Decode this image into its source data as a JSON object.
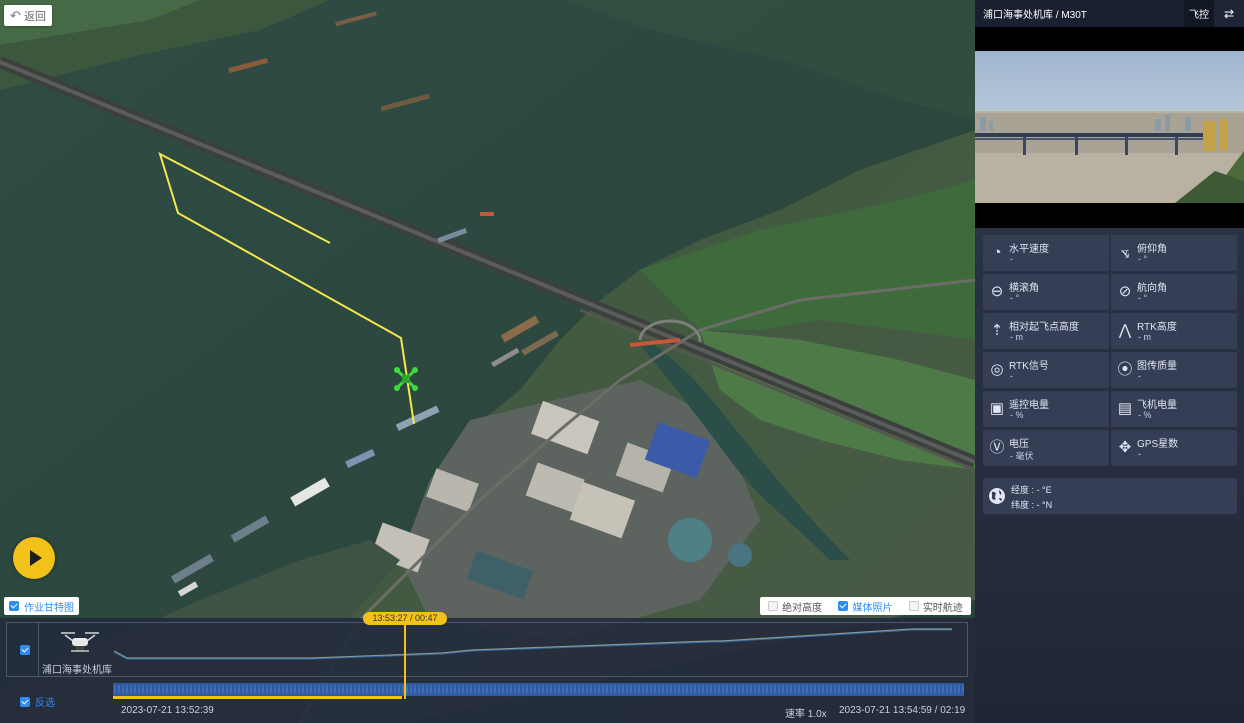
{
  "map": {
    "back_label": "返回",
    "gantt_label": "作业甘特图",
    "layer_options": [
      {
        "label": "绝对高度",
        "checked": false
      },
      {
        "label": "媒体照片",
        "checked": true
      },
      {
        "label": "实时航迹",
        "checked": false
      }
    ],
    "flight_path_color": "#f5e84a",
    "drone_marker_color": "#3ddb3d"
  },
  "timeline": {
    "drone_label": "浦口海事处机库",
    "invert_label": "反选",
    "cursor_time": "13:53:27 / 00:47",
    "start_time": "2023-07-21 13:52:39",
    "rate_label": "速率 1.0x",
    "end_time": "2023-07-21 13:54:59 / 02:19",
    "progress_fraction": 0.34,
    "accent_color": "#f2c21b"
  },
  "panel": {
    "title": "浦口海事处机库 / M30T",
    "tab_label": "飞控",
    "metrics": [
      {
        "icon": "speedometer-icon",
        "label": "水平速度",
        "value": "-"
      },
      {
        "icon": "pitch-icon",
        "label": "俯仰角",
        "value": "- °"
      },
      {
        "icon": "roll-icon",
        "label": "横滚角",
        "value": "- °"
      },
      {
        "icon": "heading-icon",
        "label": "航向角",
        "value": "- °"
      },
      {
        "icon": "takeoff-height-icon",
        "label": "相对起飞点高度",
        "value": "- m"
      },
      {
        "icon": "rtk-height-icon",
        "label": "RTK高度",
        "value": "- m"
      },
      {
        "icon": "rtk-signal-icon",
        "label": "RTK信号",
        "value": "-"
      },
      {
        "icon": "transmission-icon",
        "label": "图传质量",
        "value": "-"
      },
      {
        "icon": "remote-battery-icon",
        "label": "遥控电量",
        "value": "- %"
      },
      {
        "icon": "drone-battery-icon",
        "label": "飞机电量",
        "value": "- %"
      },
      {
        "icon": "voltage-icon",
        "label": "电压",
        "value": "- 毫伏"
      },
      {
        "icon": "satellite-icon",
        "label": "GPS星数",
        "value": "-"
      }
    ],
    "longitude_label": "经度 : - °E",
    "latitude_label": "纬度 : - °N"
  }
}
